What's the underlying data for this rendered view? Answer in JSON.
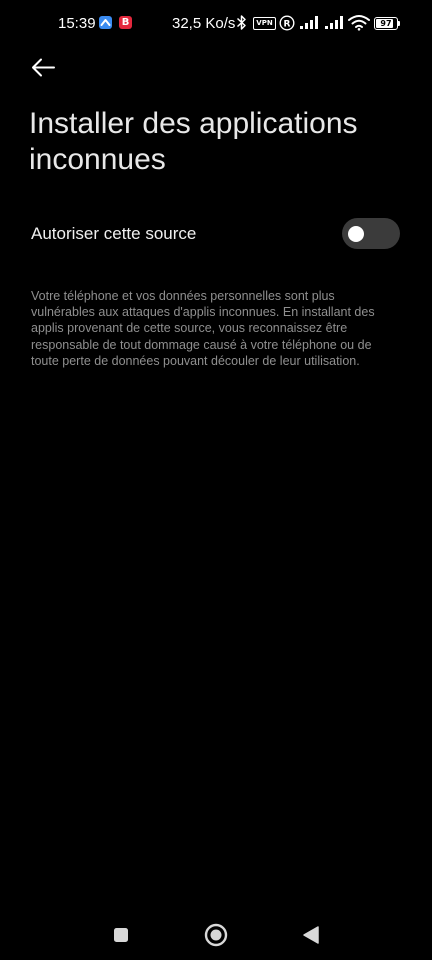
{
  "status_bar": {
    "time": "15:39",
    "app_badge_letter": "B",
    "network_speed": "32,5 Ko/s",
    "vpn_label": "VPN",
    "battery_level": "97",
    "battery_fraction": 0.97,
    "icons": [
      "blue-app-icon",
      "b-app-icon",
      "bluetooth-icon",
      "vpn-icon",
      "roaming-icon",
      "signal-icon",
      "signal-icon",
      "wifi-icon",
      "battery-icon"
    ]
  },
  "header": {
    "back_icon": "arrow-left-icon",
    "title": "Installer des applications inconnues"
  },
  "setting": {
    "label": "Autoriser cette source",
    "enabled": false
  },
  "description": "Votre téléphone et vos données personnelles sont plus vulnérables aux attaques d'applis inconnues. En installant des applis provenant de cette source, vous reconnaissez être responsable de tout dommage causé à votre téléphone ou de toute perte de données pouvant découler de leur utilisation.",
  "nav_bar": {
    "icons": [
      "recents-square-icon",
      "home-circle-icon",
      "back-triangle-icon"
    ]
  },
  "colors": {
    "background": "#000000",
    "toggle_off": "#3b3b3b",
    "description_text": "#8f8f8f"
  }
}
